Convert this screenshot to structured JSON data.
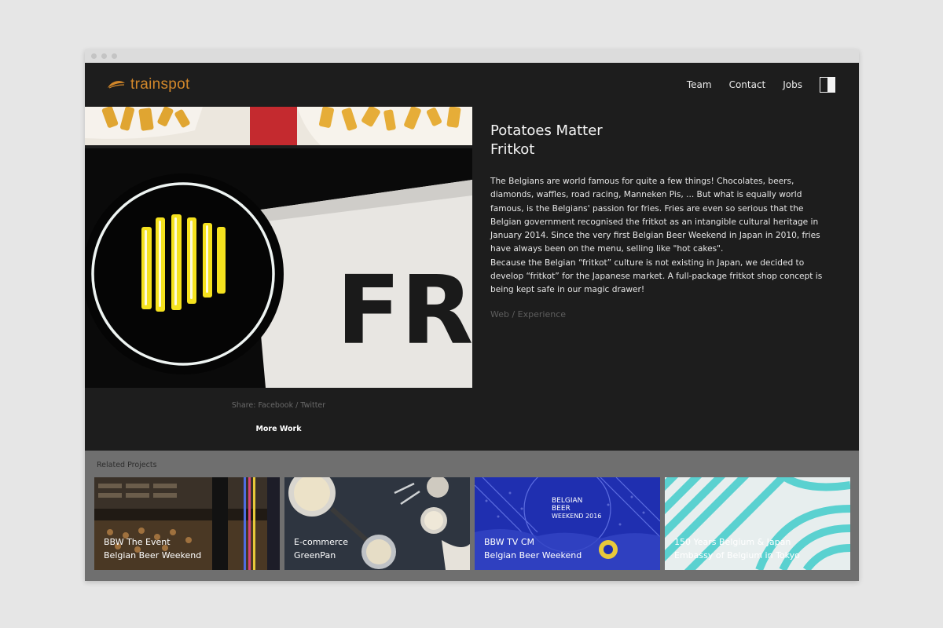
{
  "logo": {
    "text": "trainspot"
  },
  "nav": {
    "items": [
      {
        "label": "Team"
      },
      {
        "label": "Contact"
      },
      {
        "label": "Jobs"
      }
    ]
  },
  "project": {
    "title_line1": "Potatoes Matter",
    "title_line2": "Fritkot",
    "description": "The Belgians are world famous for quite a few things! Chocolates, beers, diamonds, waffles, road racing, Manneken Pis, ... But what is equally world famous, is the Belgians' passion for fries. Fries are even so serious that the Belgian government recognised the fritkot as an intangible cultural heritage in January 2014. Since the very first Belgian Beer Weekend in Japan in 2010, fries have always been on the menu, selling like \"hot cakes\".\nBecause the Belgian “fritkot” culture is not existing in Japan, we decided to develop “fritkot” for the Japanese market. A full-package fritkot shop concept is being kept safe in our magic drawer!",
    "tags": "Web / Experience",
    "sign_text": "FRI"
  },
  "share": {
    "prefix": "Share: ",
    "facebook": "Facebook",
    "separator": " / ",
    "twitter": "Twitter"
  },
  "more_work": "More Work",
  "related": {
    "title": "Related Projects",
    "cards": [
      {
        "line1": "BBW The Event",
        "line2": "Belgian Beer Weekend"
      },
      {
        "line1": "E-commerce",
        "line2": "GreenPan"
      },
      {
        "line1": "BBW TV CM",
        "line2": "Belgian Beer Weekend",
        "poster_text1": "BELGIAN",
        "poster_text2": "BEER",
        "poster_text3": "WEEKEND 2016"
      },
      {
        "line1": "150 Years Belgium & Japan",
        "line2": "Embassy of Belgium in Tokyo"
      }
    ]
  },
  "colors": {
    "accent": "#d2872a",
    "background": "#1d1d1d",
    "related_bg": "#6f6f6f"
  }
}
